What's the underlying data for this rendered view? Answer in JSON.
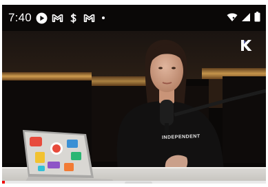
{
  "status_bar": {
    "time": "7:40",
    "notification_icons": [
      "play-icon",
      "gmail-icon",
      "dollar-icon",
      "gmail-icon"
    ],
    "system_icons": [
      "wifi-icon",
      "signal-icon",
      "battery-icon"
    ]
  },
  "video": {
    "channel_logo": "K",
    "shirt_text": "INDEPENDENT",
    "playback_progress": 0.01
  },
  "colors": {
    "background": "#0b0908",
    "accent_glow": "#e6b25a",
    "progress": "#ee0000"
  }
}
